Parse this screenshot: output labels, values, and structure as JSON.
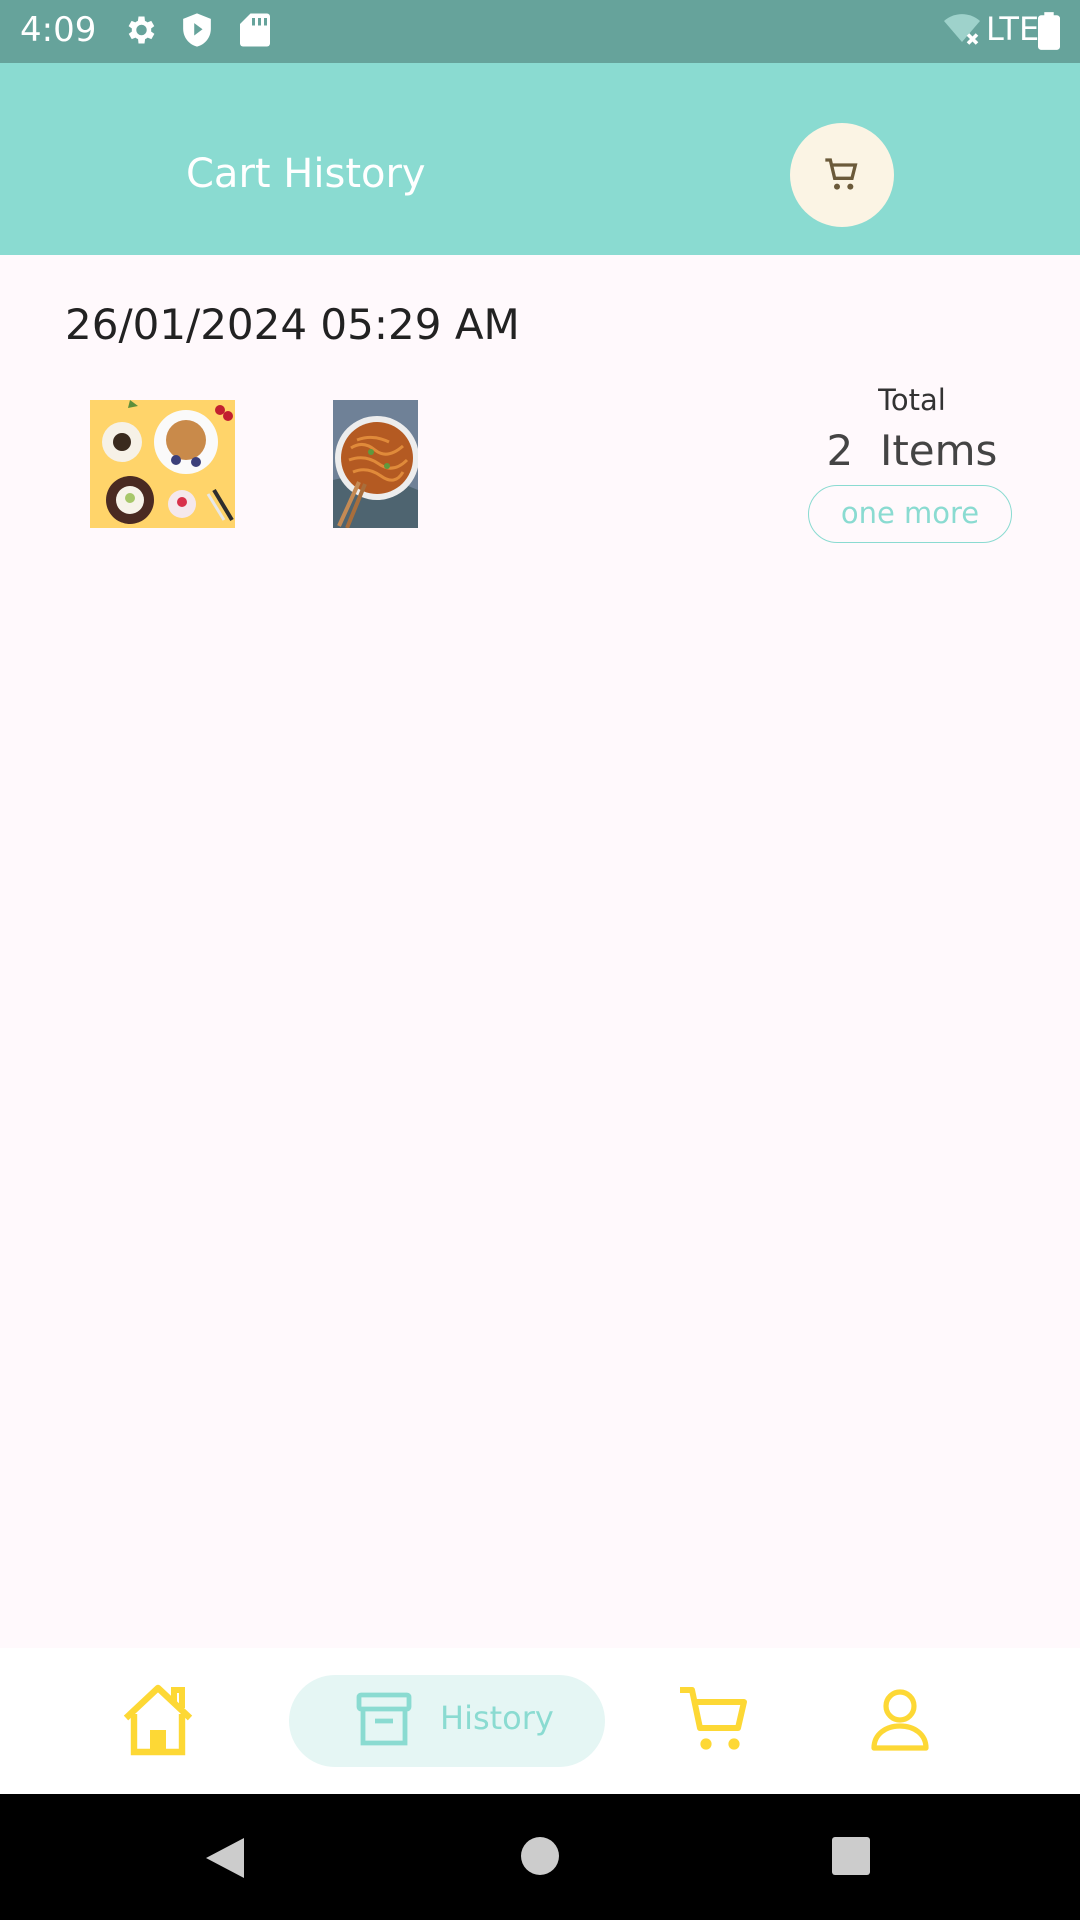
{
  "status_bar": {
    "time": "4:09",
    "network": "LTE",
    "icons": [
      "settings-icon",
      "shield-icon",
      "sd-card-icon",
      "wifi-off-icon",
      "battery-icon"
    ]
  },
  "app_bar": {
    "title": "Cart History",
    "action_icon": "cart-icon"
  },
  "order": {
    "date": "26/01/2024 05:29 AM",
    "thumbnails": [
      "desserts-image",
      "noodles-image"
    ],
    "total_label": "Total",
    "count_text": "2  Items",
    "one_more_label": "one more"
  },
  "bottom_nav": {
    "items": [
      {
        "icon": "home-icon",
        "label": ""
      },
      {
        "icon": "archive-icon",
        "label": "History"
      },
      {
        "icon": "cart-icon",
        "label": ""
      },
      {
        "icon": "person-icon",
        "label": ""
      }
    ],
    "active_index": 1
  },
  "colors": {
    "accent": "#8ADBD1",
    "status_bar": "#66A39B",
    "nav_icon": "#FDD835",
    "background": "#FFF9FC"
  }
}
